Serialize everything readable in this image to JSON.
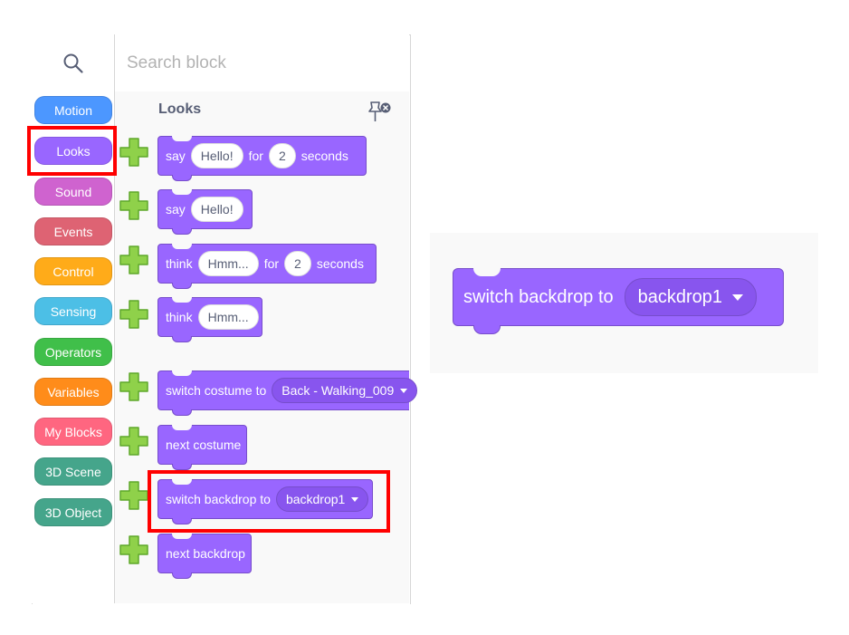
{
  "search": {
    "placeholder": "Search block"
  },
  "categories": [
    {
      "label": "Motion",
      "color": "#4c97ff"
    },
    {
      "label": "Looks",
      "color": "#9966ff"
    },
    {
      "label": "Sound",
      "color": "#cf63cf"
    },
    {
      "label": "Events",
      "color": "#de6373"
    },
    {
      "label": "Control",
      "color": "#ffab19"
    },
    {
      "label": "Sensing",
      "color": "#4cbfe6"
    },
    {
      "label": "Operators",
      "color": "#40bf4a"
    },
    {
      "label": "Variables",
      "color": "#ff8c1a"
    },
    {
      "label": "My Blocks",
      "color": "#ff6680"
    },
    {
      "label": "3D Scene",
      "color": "#45a58b"
    },
    {
      "label": "3D Object",
      "color": "#45a58b"
    }
  ],
  "palette": {
    "heading": "Looks",
    "blocks": [
      {
        "w1": "say",
        "v1": "Hello!",
        "w2": "for",
        "v2": "2",
        "w3": "seconds"
      },
      {
        "w1": "say",
        "v1": "Hello!"
      },
      {
        "w1": "think",
        "v1": "Hmm...",
        "w2": "for",
        "v2": "2",
        "w3": "seconds"
      },
      {
        "w1": "think",
        "v1": "Hmm..."
      },
      {
        "w1": "switch costume to",
        "drop": "Back - Walking_009"
      },
      {
        "w1": "next costume"
      },
      {
        "w1": "switch backdrop to",
        "drop": "backdrop1"
      },
      {
        "w1": "next backdrop"
      }
    ]
  },
  "zoom": {
    "label": "switch backdrop to",
    "drop": "backdrop1"
  },
  "colors": {
    "highlight": "#ff0000",
    "looks": "#9966ff"
  }
}
